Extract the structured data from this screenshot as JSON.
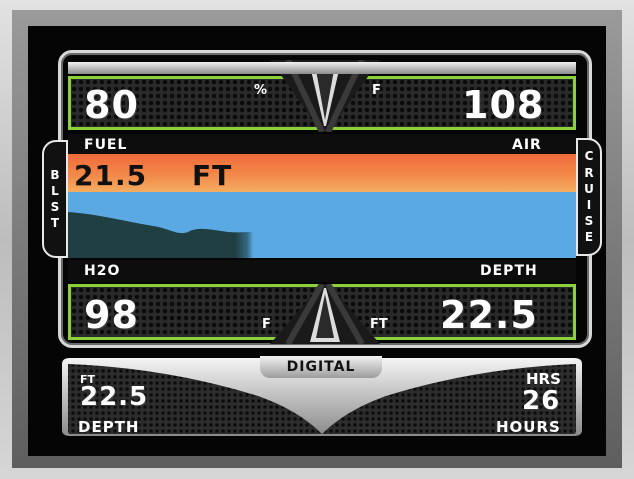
{
  "gauges": {
    "fuel": {
      "value": "80",
      "unit": "%",
      "label": "FUEL"
    },
    "air": {
      "value": "108",
      "unit": "F",
      "label": "AIR"
    },
    "h2o": {
      "value": "98",
      "unit": "F",
      "label": "H2O"
    },
    "depth": {
      "value": "22.5",
      "unit": "FT",
      "label": "DEPTH"
    }
  },
  "sonar": {
    "depth_value": "21.5",
    "depth_unit": "FT"
  },
  "side_tabs": {
    "left": [
      "B",
      "L",
      "S",
      "T"
    ],
    "right": [
      "C",
      "R",
      "U",
      "I",
      "S",
      "E"
    ]
  },
  "mode_tab": {
    "label": "DIGITAL"
  },
  "bottom": {
    "depth": {
      "unit": "FT",
      "value": "22.5",
      "label": "DEPTH"
    },
    "hours": {
      "unit": "HRS",
      "value": "26",
      "label": "HOURS"
    }
  },
  "colors": {
    "accent": "#8bd13a",
    "sky": "#f27d44",
    "water": "#5ba9e3",
    "terrain": "#1f3f43"
  }
}
